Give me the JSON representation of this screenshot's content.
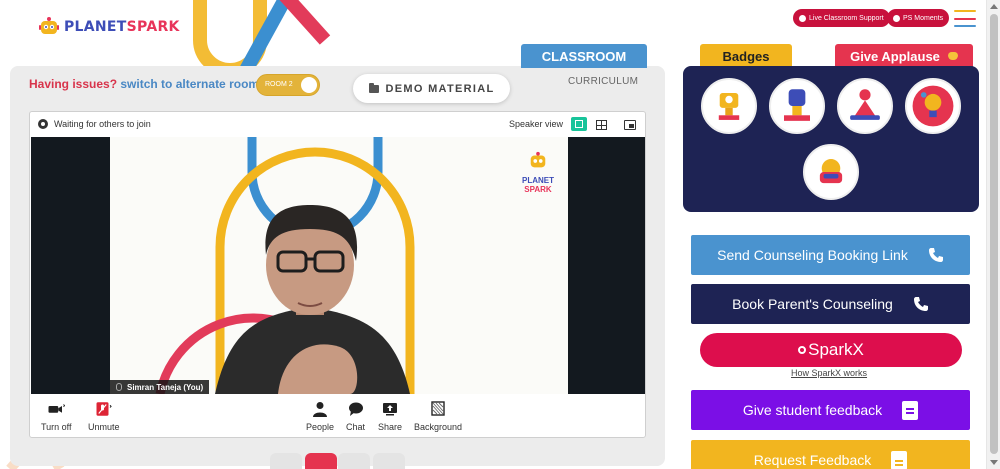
{
  "header": {
    "brand_part1": "PLANET",
    "brand_part2": "SPARK",
    "live_support_label": "Live Classroom Support",
    "ps_moments_label": "PS Moments"
  },
  "tabs": {
    "classroom": "CLASSROOM",
    "curriculum": "CURRICULUM",
    "badges": "Badges",
    "applause": "Give Applause"
  },
  "issues": {
    "prefix": "Having issues?",
    "link": "switch to alternate room",
    "room_label": "ROOM 2"
  },
  "demo_material_label": "DEMO MATERIAL",
  "video": {
    "status": "Waiting for others to join",
    "view_mode": "Speaker view",
    "participant_name": "Simran Taneja (You)",
    "feed_logo_line1": "PLANET",
    "feed_logo_line2": "SPARK",
    "controls": {
      "turn_off": "Turn off",
      "unmute": "Unmute",
      "people": "People",
      "chat": "Chat",
      "share": "Share",
      "background": "Background"
    }
  },
  "actions": {
    "counseling_link": "Send Counseling Booking Link",
    "parent_counseling": "Book Parent's Counseling",
    "sparkx": "SparkX",
    "sparkx_help": "How SparkX works",
    "student_feedback": "Give student feedback",
    "request_feedback": "Request Feedback"
  },
  "colors": {
    "classroom_tab": "#4a93cf",
    "badges_tab": "#f2b51f",
    "applause_tab": "#e5344f",
    "badges_panel": "#1e2354",
    "counseling_link_btn": "#4a93cf",
    "parent_counseling_btn": "#1e2354",
    "sparkx_btn": "#dd0e4d",
    "student_feedback_btn": "#7b0fe6",
    "request_feedback_btn": "#f2b51f"
  }
}
